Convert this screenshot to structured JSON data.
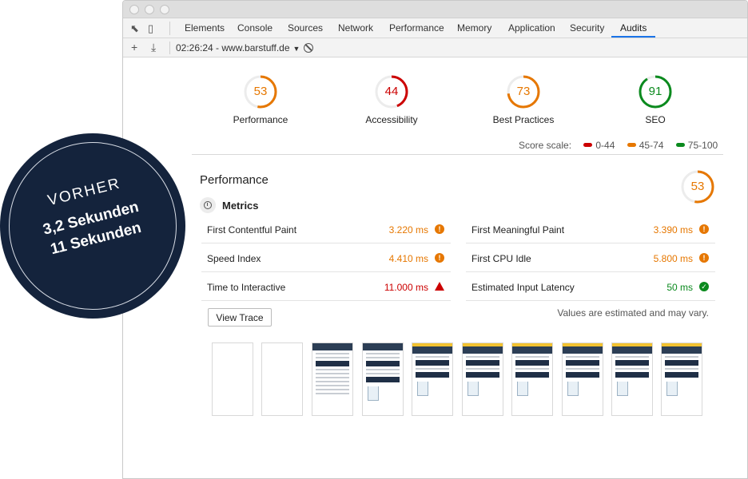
{
  "devtools": {
    "tabs": [
      {
        "label": "Elements"
      },
      {
        "label": "Console"
      },
      {
        "label": "Sources"
      },
      {
        "label": "Network"
      },
      {
        "label": "Performance"
      },
      {
        "label": "Memory"
      },
      {
        "label": "Application"
      },
      {
        "label": "Security"
      },
      {
        "label": "Audits",
        "active": true
      }
    ],
    "report_selector": "02:26:24 - www.barstuff.de"
  },
  "categories": [
    {
      "label": "Performance",
      "score": "53",
      "level": 0.53,
      "color": "#e67700"
    },
    {
      "label": "Accessibility",
      "score": "44",
      "level": 0.44,
      "color": "#cc0000"
    },
    {
      "label": "Best Practices",
      "score": "73",
      "level": 0.73,
      "color": "#e67700"
    },
    {
      "label": "SEO",
      "score": "91",
      "level": 0.91,
      "color": "#0b8a1e"
    }
  ],
  "score_scale": {
    "label": "Score scale:",
    "ranges": [
      {
        "label": "0-44",
        "color": "#cc0000"
      },
      {
        "label": "45-74",
        "color": "#e67700"
      },
      {
        "label": "75-100",
        "color": "#0b8a1e"
      }
    ]
  },
  "performance": {
    "title": "Performance",
    "score": "53",
    "metrics_title": "Metrics",
    "metrics_left": [
      {
        "name": "First Contentful Paint",
        "value": "3.220 ms",
        "status": "average"
      },
      {
        "name": "Speed Index",
        "value": "4.410 ms",
        "status": "average"
      },
      {
        "name": "Time to Interactive",
        "value": "11.000 ms",
        "status": "fail"
      }
    ],
    "metrics_right": [
      {
        "name": "First Meaningful Paint",
        "value": "3.390 ms",
        "status": "average"
      },
      {
        "name": "First CPU Idle",
        "value": "5.800 ms",
        "status": "average"
      },
      {
        "name": "Estimated Input Latency",
        "value": "50 ms",
        "status": "pass"
      }
    ],
    "view_trace_label": "View Trace",
    "estimate_note": "Values are estimated and may vary."
  },
  "badge": {
    "before": "VORHER",
    "line1": "3,2 Sekunden",
    "line2": "11 Sekunden"
  },
  "colors": {
    "badge_bg": "#14233c",
    "tab_active": "#1a73e8"
  }
}
